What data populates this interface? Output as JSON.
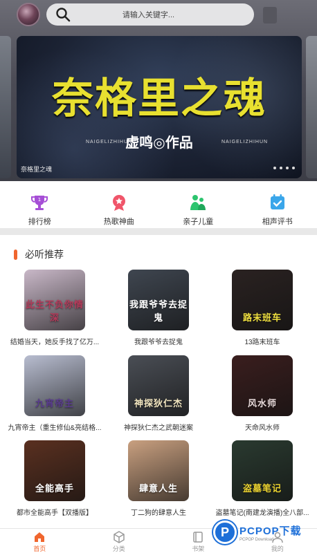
{
  "header": {
    "search_placeholder": "请输入关键字..."
  },
  "banner": {
    "title": "奈格里之魂",
    "author": "虚鸣◎作品",
    "pinyin": "NAIGELIZHIHUN",
    "caption": "奈格里之魂"
  },
  "categories": [
    {
      "label": "排行榜",
      "icon": "trophy-icon",
      "color": "#a64fd6"
    },
    {
      "label": "热歌神曲",
      "icon": "hot-song-icon",
      "color": "#f0556a"
    },
    {
      "label": "亲子儿童",
      "icon": "parent-child-icon",
      "color": "#2cc46e"
    },
    {
      "label": "相声评书",
      "icon": "book-icon",
      "color": "#3aa6ea"
    }
  ],
  "recommend": {
    "title": "必听推荐",
    "items": [
      {
        "name": "结婚当天，她反手找了亿万...",
        "cover_text": "此生不负你情深",
        "bg": "#c9b8c8",
        "fg": "#b53a5a"
      },
      {
        "name": "我跟爷爷去捉鬼",
        "cover_text": "我跟爷爷去捉鬼",
        "bg": "#3f4650",
        "fg": "#ffffff"
      },
      {
        "name": "13路末班车",
        "cover_text": "路末班车",
        "bg": "#2a2221",
        "fg": "#f0e040"
      },
      {
        "name": "九宵帝主（重生修仙&亮结格...",
        "cover_text": "九宵帝主",
        "bg": "#b8bdd0",
        "fg": "#5a3c8e"
      },
      {
        "name": "神探狄仁杰之武朝迷案",
        "cover_text": "神探狄仁杰",
        "bg": "#4a4e55",
        "fg": "#f2e6c0"
      },
      {
        "name": "天命风水师",
        "cover_text": "风水师",
        "bg": "#3a1e1e",
        "fg": "#e8dada"
      },
      {
        "name": "都市全能高手【双播版】",
        "cover_text": "全能高手",
        "bg": "#5a3020",
        "fg": "#ffffff"
      },
      {
        "name": "丁二狗的肆意人生",
        "cover_text": "肆意人生",
        "bg": "#c9a080",
        "fg": "#ffffff"
      },
      {
        "name": "盗墓笔记(南建龙演播)全八部...",
        "cover_text": "盗墓笔记",
        "bg": "#2a3a30",
        "fg": "#e8d030"
      }
    ]
  },
  "nav": [
    {
      "label": "首页",
      "icon": "home-icon",
      "active": true
    },
    {
      "label": "分类",
      "icon": "category-icon",
      "active": false
    },
    {
      "label": "书架",
      "icon": "bookshelf-icon",
      "active": false
    },
    {
      "label": "我的",
      "icon": "profile-icon",
      "active": false
    }
  ],
  "watermark": {
    "main": "PCPOP下载",
    "sub": "PCPOP Download",
    "logo": "P"
  },
  "colors": {
    "accent": "#f0662e",
    "banner_title": "#e8e030"
  }
}
